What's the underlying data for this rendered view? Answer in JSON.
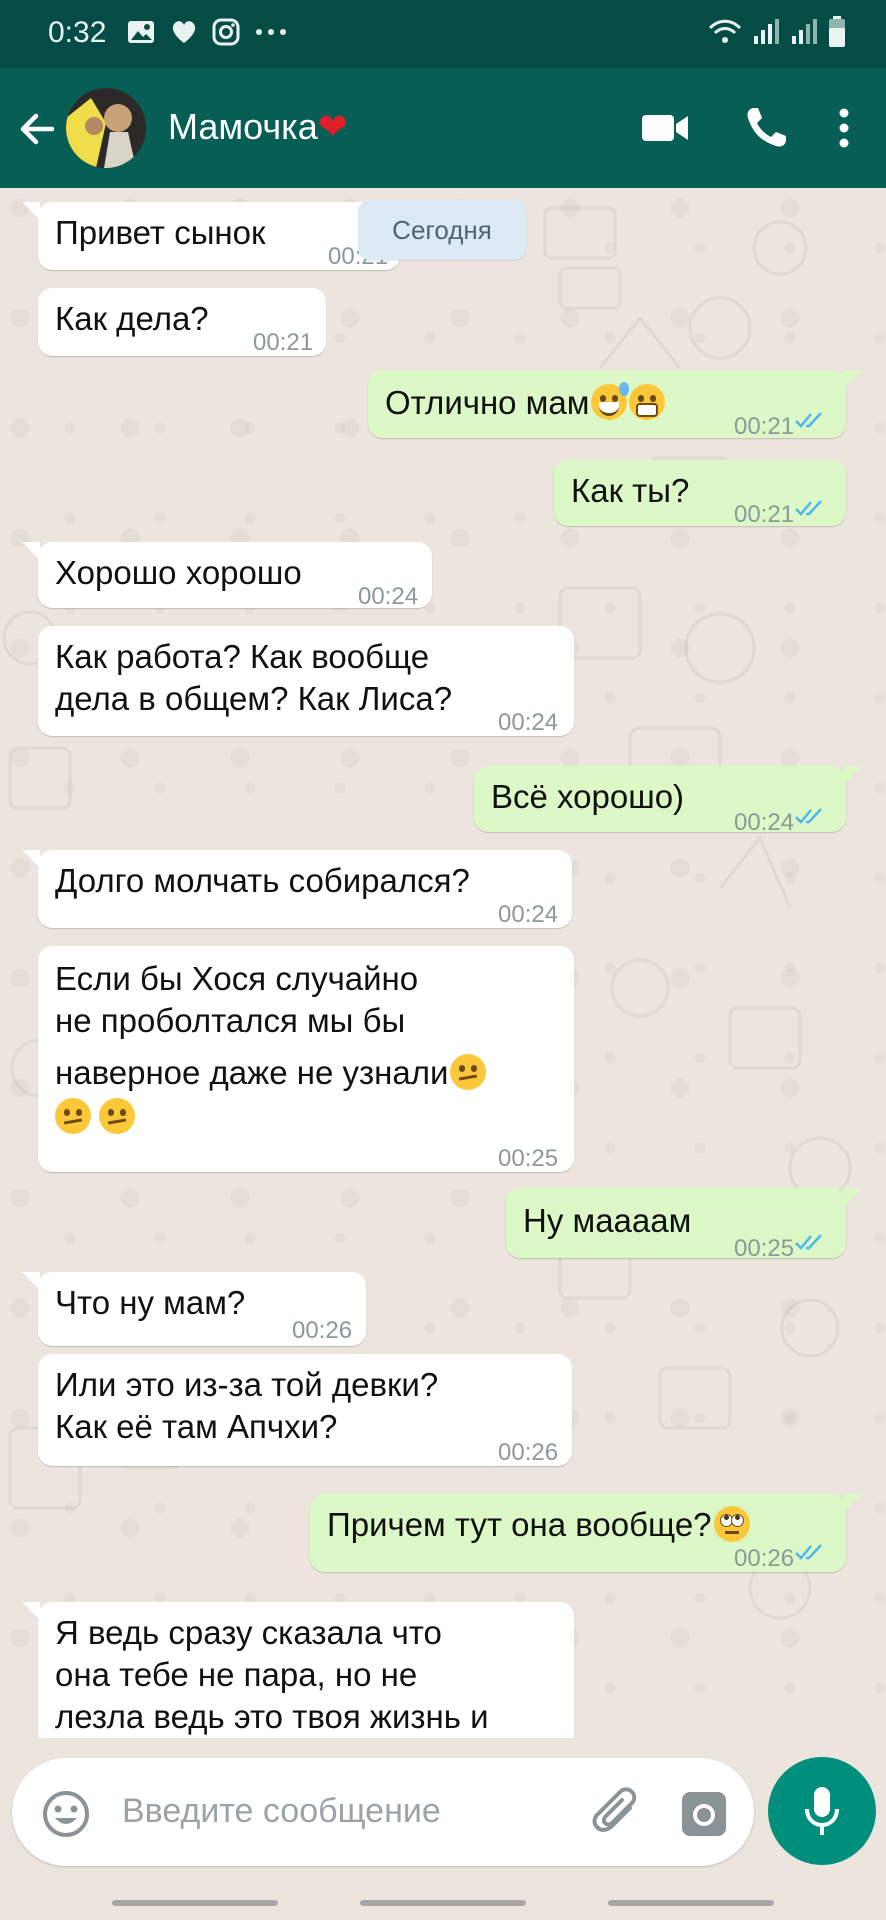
{
  "status_bar": {
    "time": "0:32"
  },
  "header": {
    "contact_name": "Мамочка",
    "heart": "❤",
    "icons": [
      "back-arrow-icon",
      "video-call-icon",
      "phone-icon",
      "more-vert-icon"
    ]
  },
  "date_chip": "Сегодня",
  "messages": [
    {
      "dir": "in",
      "text": "Привет сынок",
      "time": "00:21"
    },
    {
      "dir": "in",
      "text": "Как дела?",
      "time": "00:21"
    },
    {
      "dir": "out",
      "text": "Отлично мам",
      "time": "00:21",
      "emoji": [
        "sweat-smile",
        "grimace"
      ]
    },
    {
      "dir": "out",
      "text": "Как ты?",
      "time": "00:21"
    },
    {
      "dir": "in",
      "text": "Хорошо хорошо",
      "time": "00:24"
    },
    {
      "dir": "in",
      "text_lines": [
        "Как работа? Как вообще",
        "дела в общем? Как Лиса?"
      ],
      "time": "00:24"
    },
    {
      "dir": "out",
      "text": "Всё хорошо)",
      "time": "00:24"
    },
    {
      "dir": "in",
      "text": "Долго молчать собирался?",
      "time": "00:24"
    },
    {
      "dir": "in",
      "text_lines": [
        "Если бы Хося случайно",
        "не проболтался мы бы",
        "наверное даже не узнали"
      ],
      "time": "00:25",
      "emoji": [
        "confused",
        "confused",
        "confused"
      ]
    },
    {
      "dir": "out",
      "text": "Ну маааам",
      "time": "00:25"
    },
    {
      "dir": "in",
      "text": "Что ну мам?",
      "time": "00:26"
    },
    {
      "dir": "in",
      "text_lines": [
        "Или это из-за той девки?",
        "Как её там Апчхи?"
      ],
      "time": "00:26"
    },
    {
      "dir": "out",
      "text": "Причем тут она вообще?",
      "time": "00:26",
      "emoji": [
        "eye-roll"
      ]
    },
    {
      "dir": "in",
      "text_lines": [
        "Я ведь сразу сказала что",
        "она тебе не пара, но не",
        "лезла ведь это твоя жизнь и"
      ]
    }
  ],
  "input": {
    "placeholder": "Введите сообщение"
  },
  "colors": {
    "status_bar": "#054d44",
    "header": "#075e54",
    "outgoing_bubble": "#dcf8c6",
    "incoming_bubble": "#ffffff",
    "chat_bg": "#ece5dd",
    "read_ticks": "#4fb6ec",
    "mic_button": "#008f7d"
  }
}
